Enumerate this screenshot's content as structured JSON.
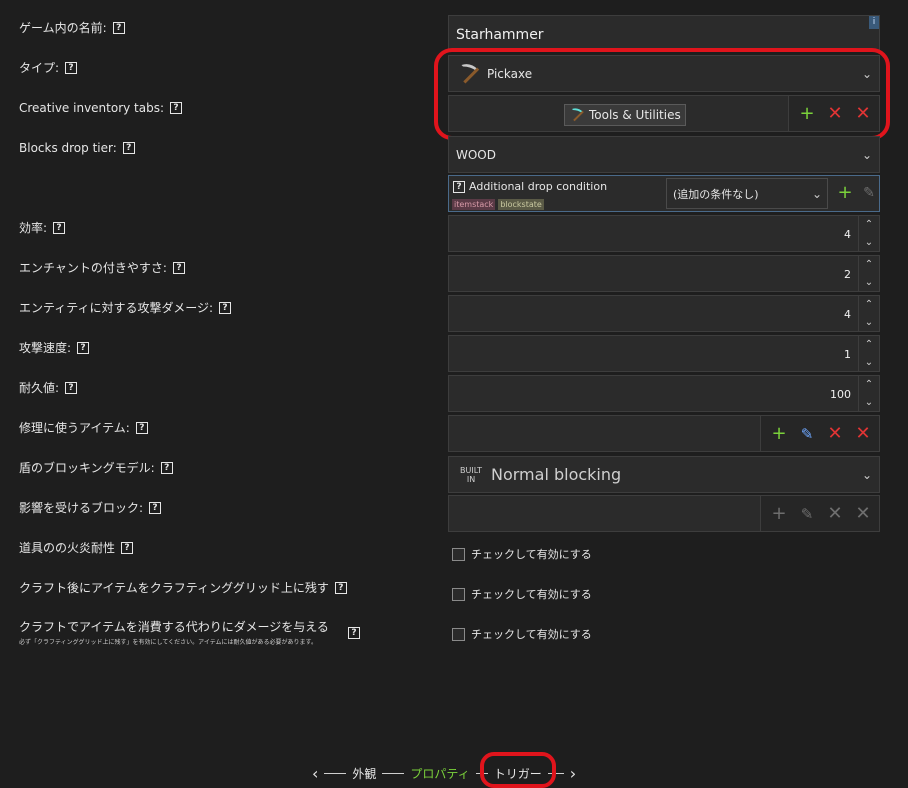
{
  "labels": {
    "name": "ゲーム内の名前:",
    "type": "タイプ:",
    "tabs": "Creative inventory tabs:",
    "drop_tier": "Blocks drop tier:",
    "efficiency": "効率:",
    "enchant": "エンチャントの付きやすさ:",
    "entity_damage": "エンティティに対する攻撃ダメージ:",
    "attack_speed": "攻撃速度:",
    "durability": "耐久値:",
    "repair": "修理に使うアイテム:",
    "shield": "盾のブロッキングモデル:",
    "affected_blocks": "影響を受けるブロック:",
    "fire_resist": "道具のの火炎耐性",
    "leave_grid": "クラフト後にアイテムをクラフティンググリッド上に残す",
    "damage_instead": "クラフトでアイテムを消費する代わりにダメージを与える",
    "damage_note": "必ず「クラフティンググリッド上に残す」を有効にしてください。アイテムには耐久値がある必要があります。"
  },
  "help_glyph": "?",
  "name_value": "Starhammer",
  "info_glyph": "i",
  "type_value": "Pickaxe",
  "tab_value": "Tools & Utilities",
  "drop_tier_value": "WOOD",
  "drop_condition": {
    "title": "Additional drop condition",
    "tag1": "itemstack",
    "tag2": "blockstate",
    "select": "(追加の条件なし)"
  },
  "numbers": {
    "efficiency": "4",
    "enchant": "2",
    "entity_damage": "4",
    "attack_speed": "1",
    "durability": "100"
  },
  "shield_badge_line1": "BUILT",
  "shield_badge_line2": "IN",
  "shield_value": "Normal blocking",
  "check_label": "チェックして有効にする",
  "nav": {
    "appearance": "外観",
    "properties": "プロパティ",
    "triggers": "トリガー"
  },
  "colors": {
    "accent_green": "#7bd23b",
    "remove_red": "#e03434",
    "highlight_red": "#e0141c"
  }
}
